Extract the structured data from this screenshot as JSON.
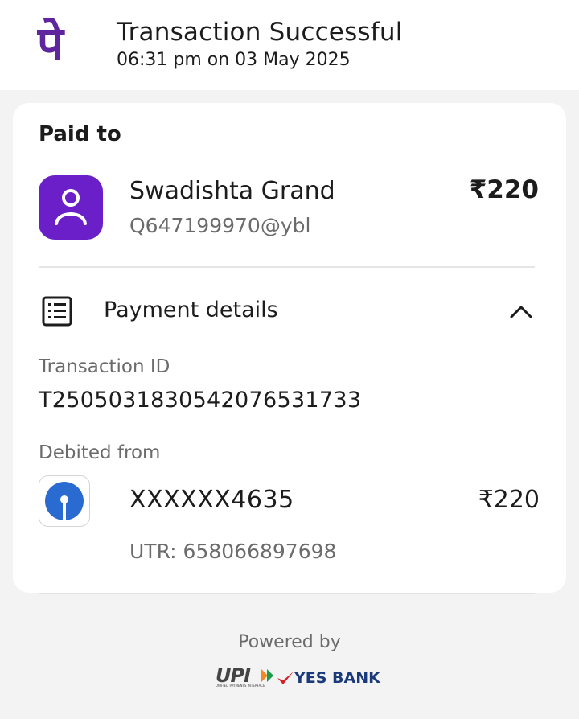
{
  "header": {
    "title": "Transaction Successful",
    "subtitle": "06:31 pm on 03 May 2025",
    "brand_icon": "phonepe-logo",
    "brand_color": "#5f259f"
  },
  "payee": {
    "section_label": "Paid to",
    "name": "Swadishta Grand",
    "upi_id": "Q647199970@ybl",
    "amount": "₹220",
    "avatar_icon": "person-icon",
    "avatar_color": "#6a1fc9"
  },
  "details": {
    "label": "Payment details",
    "icon": "receipt-list-icon",
    "toggle_icon": "chevron-up-icon",
    "transaction_id_label": "Transaction ID",
    "transaction_id": "T2505031830542076531733",
    "debited_label": "Debited from",
    "account": "XXXXXX4635",
    "debit_amount": "₹220",
    "utr": "UTR: 658066897698",
    "bank_icon": "sbi-logo",
    "bank_color": "#2a6bd1"
  },
  "footer": {
    "powered_by": "Powered by",
    "upi_logo_text": "UPI",
    "upi_logo_subtext": "UNIFIED PAYMENTS INTERFACE",
    "bank_logo_text": "YES BANK"
  }
}
